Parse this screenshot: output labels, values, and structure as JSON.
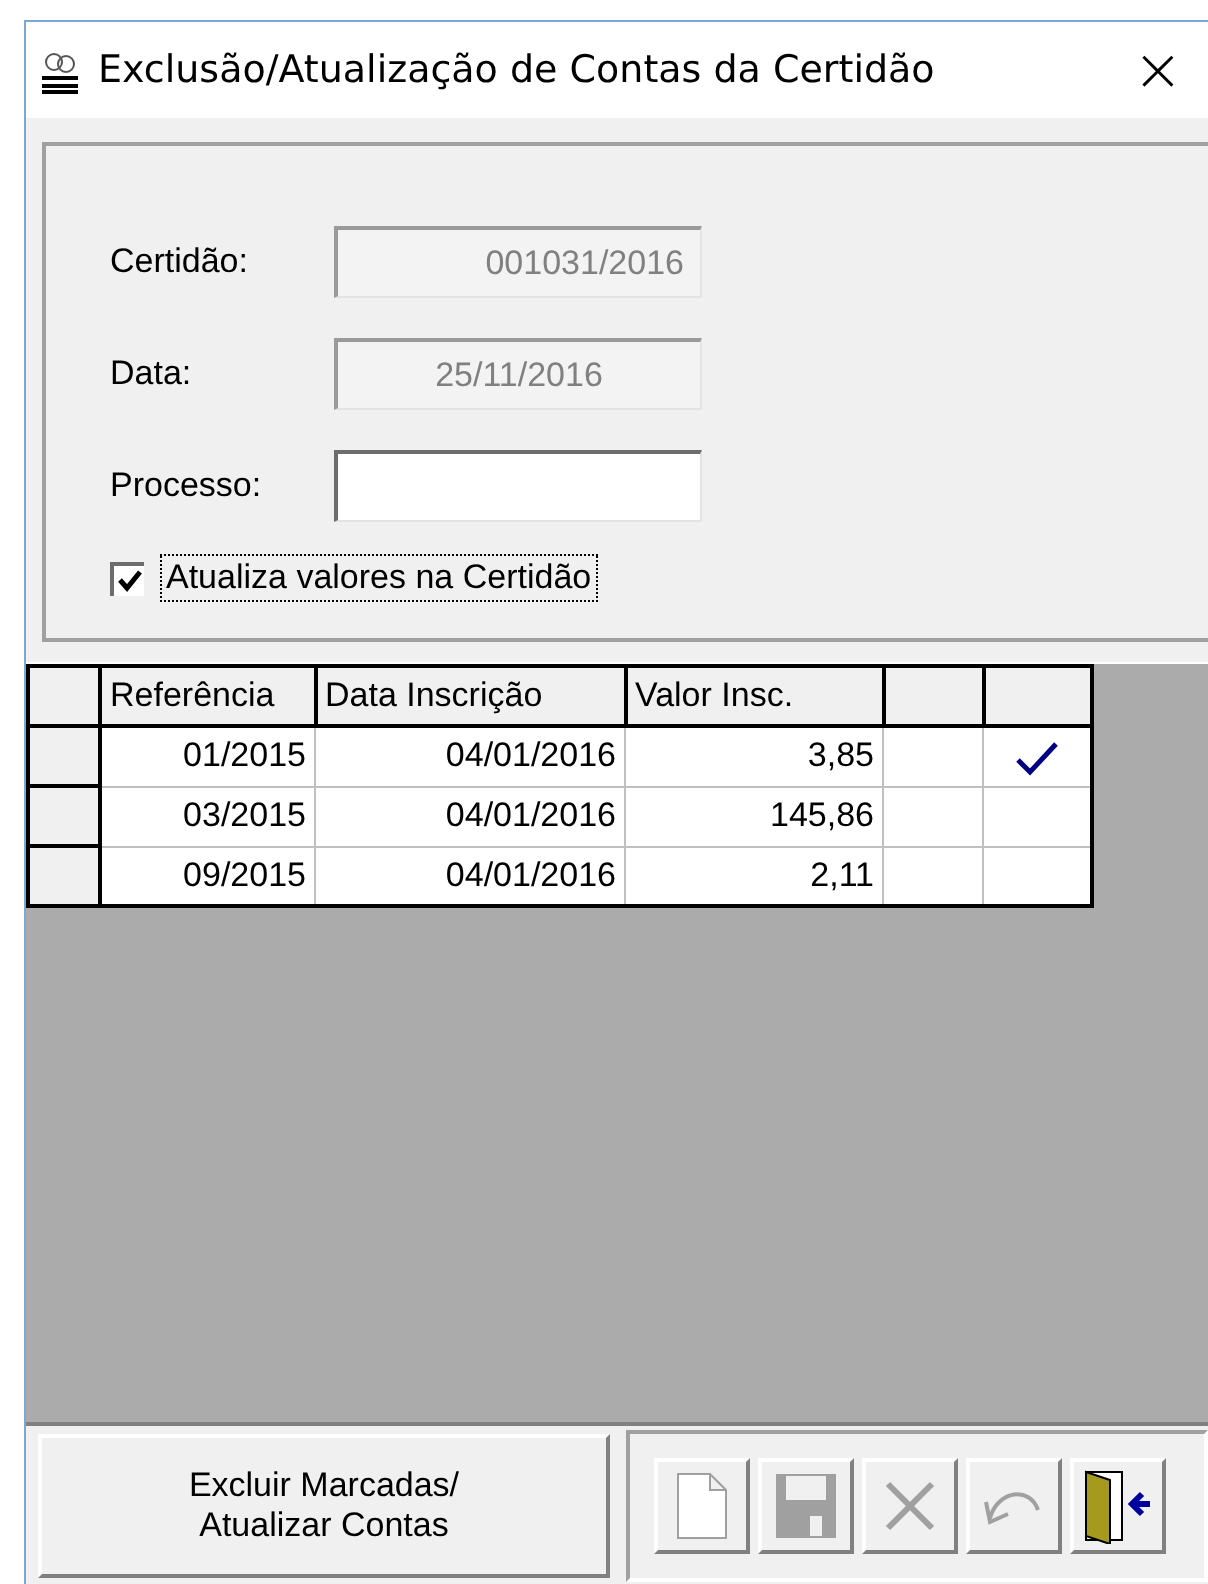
{
  "window": {
    "title": "Exclusão/Atualização de Contas da Certidão",
    "close": "×"
  },
  "fields": [
    {
      "label": "Certidão:",
      "value": "001031/2016",
      "disabled": true
    },
    {
      "label": "Data:",
      "value": "25/11/2016",
      "disabled": true
    },
    {
      "label": "Processo:",
      "disabled": false
    }
  ],
  "checkbox": {
    "label": "Atualiza valores na Certidão",
    "checked": true
  },
  "table": {
    "columns": [
      "Referência",
      "Data Inscrição",
      "Valor Insc."
    ],
    "rows": [
      {
        "cells": [
          "01/2015",
          "04/01/2016",
          "3,85"
        ],
        "marked": true
      },
      {
        "cells": [
          "03/2015",
          "04/01/2016",
          "145,86"
        ],
        "marked": false
      },
      {
        "cells": [
          "09/2015",
          "04/01/2016",
          "2,11"
        ],
        "marked": false
      }
    ]
  },
  "action_button": {
    "label": "Excluir Marcadas/\nAtualizar Contas"
  },
  "toolbar": [
    {
      "kind": "new",
      "disabled": true
    },
    {
      "kind": "save",
      "disabled": true
    },
    {
      "kind": "delete",
      "disabled": true
    },
    {
      "kind": "undo",
      "disabled": true
    },
    {
      "kind": "exit",
      "disabled": false
    }
  ]
}
